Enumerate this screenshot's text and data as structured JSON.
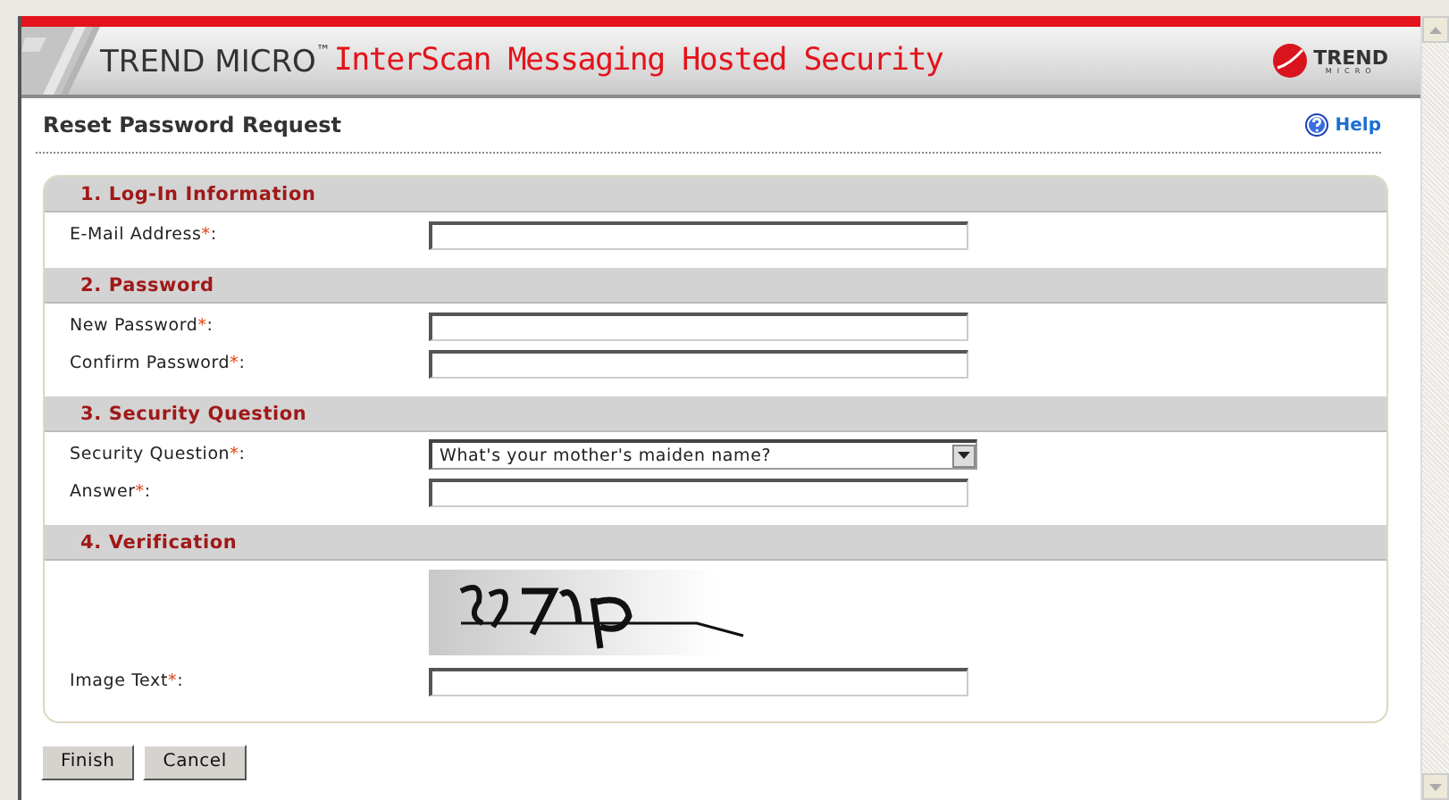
{
  "header": {
    "brand": "TREND MICRO",
    "brand_mark": "™",
    "product": "InterScan Messaging Hosted Security",
    "logo_top": "TREND",
    "logo_bottom": "MICRO"
  },
  "page": {
    "title": "Reset Password Request",
    "help": "Help"
  },
  "sections": [
    {
      "title": "1. Log-In Information",
      "fields": [
        {
          "kind": "text",
          "label": "E-Mail Address",
          "asterisk": "*",
          "suffix": ":"
        }
      ]
    },
    {
      "title": "2. Password",
      "fields": [
        {
          "kind": "text",
          "label": "New Password",
          "asterisk": "*",
          "suffix": ":"
        },
        {
          "kind": "text",
          "label": "Confirm Password",
          "asterisk": "*",
          "suffix": ":"
        }
      ]
    },
    {
      "title": "3. Security Question",
      "fields": [
        {
          "kind": "select",
          "label": "Security Question",
          "asterisk": "*",
          "suffix": ":",
          "value": "What's your mother's maiden name?"
        },
        {
          "kind": "text",
          "label": "Answer",
          "asterisk": "*",
          "suffix": ":"
        }
      ]
    },
    {
      "title": "4. Verification",
      "fields": [
        {
          "kind": "captcha"
        },
        {
          "kind": "text",
          "label": "Image Text",
          "asterisk": "*",
          "suffix": ":"
        }
      ]
    }
  ],
  "buttons": [
    "Finish",
    "Cancel"
  ]
}
